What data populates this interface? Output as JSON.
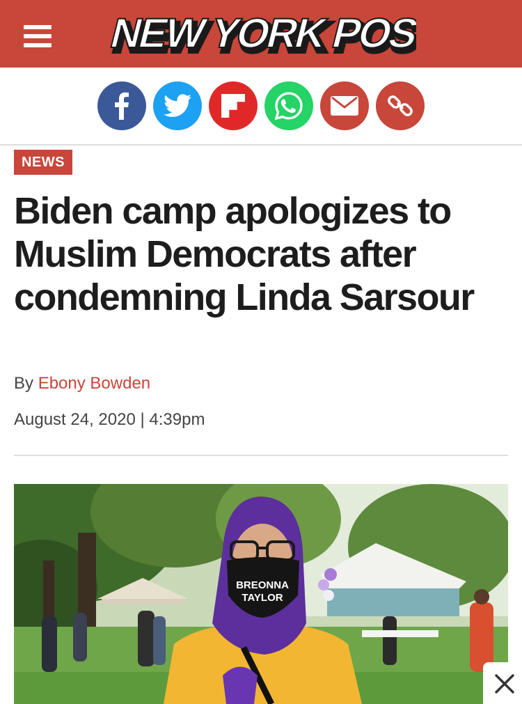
{
  "header": {
    "brand": "NEW YORK POST",
    "brand_color": "#c8463a",
    "menu_icon": "hamburger-menu-icon"
  },
  "share": [
    {
      "icon": "facebook-icon",
      "color": "#3b5998"
    },
    {
      "icon": "twitter-icon",
      "color": "#1da1f2"
    },
    {
      "icon": "flipboard-icon",
      "color": "#e12828"
    },
    {
      "icon": "whatsapp-icon",
      "color": "#25d366"
    },
    {
      "icon": "email-icon",
      "color": "#c8463a"
    },
    {
      "icon": "link-icon",
      "color": "#c8463a"
    }
  ],
  "article": {
    "category": "NEWS",
    "headline": "Biden camp apologizes to Muslim Democrats after condemning Linda Sarsour",
    "by_prefix": "By",
    "author": "Ebony Bowden",
    "date": "August 24, 2020 | 4:39pm"
  },
  "photo": {
    "mask_text_line1": "BREONNA",
    "mask_text_line2": "TAYLOR"
  },
  "overlay": {
    "close_icon": "close-icon"
  }
}
